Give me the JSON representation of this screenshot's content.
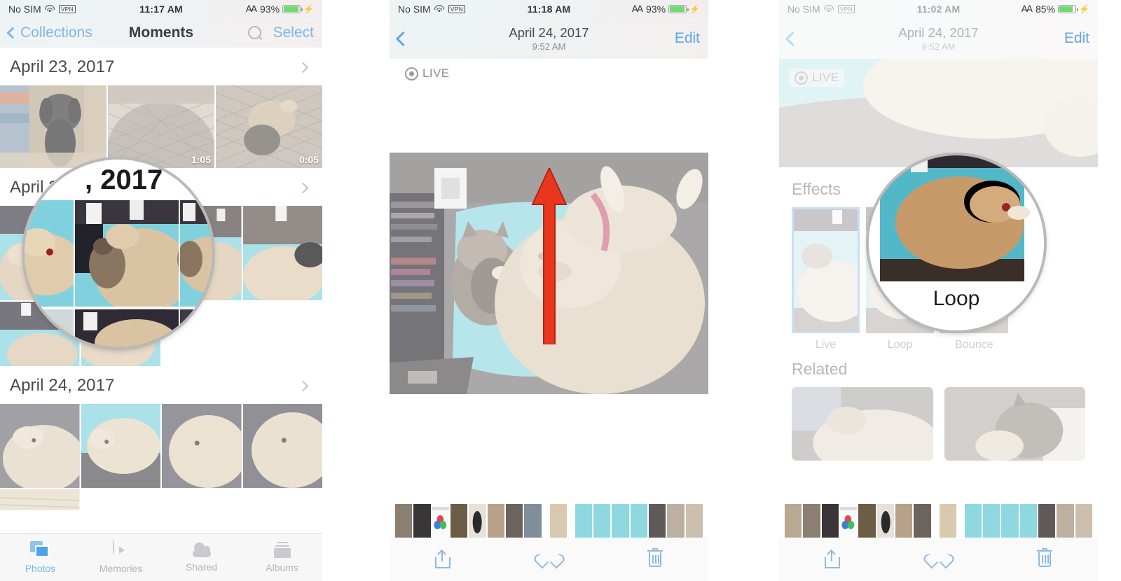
{
  "panels": [
    {
      "id": "moments-grid",
      "status": {
        "carrier": "No SIM",
        "wifi_icon": "wifi-icon",
        "vpn": "VPN",
        "time": "11:17 AM",
        "bluetooth_icon": "bluetooth-icon",
        "battery_pct": "93%",
        "charging_icon": "lightning-bolt-icon"
      },
      "nav": {
        "back_label": "Collections",
        "title": "Moments",
        "search_icon": "search-icon",
        "action_label": "Select"
      },
      "sections": [
        {
          "date": "April 23, 2017",
          "durations": [
            "",
            "1:05",
            "0:05"
          ]
        },
        {
          "date": "April 24, 2017",
          "durations": []
        },
        {
          "date": "April 24, 2017",
          "durations": []
        }
      ],
      "magnified_text": "2017",
      "tabs": [
        {
          "label": "Photos",
          "icon": "photos-icon",
          "active": true
        },
        {
          "label": "Memories",
          "icon": "memories-icon",
          "active": false
        },
        {
          "label": "Shared",
          "icon": "cloud-icon",
          "active": false
        },
        {
          "label": "Albums",
          "icon": "albums-icon",
          "active": false
        }
      ]
    },
    {
      "id": "photo-detail",
      "status": {
        "carrier": "No SIM",
        "wifi_icon": "wifi-icon",
        "vpn": "VPN",
        "time": "11:18 AM",
        "bluetooth_icon": "bluetooth-icon",
        "battery_pct": "93%",
        "charging_icon": "lightning-bolt-icon"
      },
      "nav": {
        "back_icon": "back-chevron-icon",
        "title": "April 24, 2017",
        "subtitle": "9:52 AM",
        "action_label": "Edit"
      },
      "live_badge": "LIVE",
      "gesture": {
        "type": "swipe-up-arrow",
        "color": "#e8361f"
      },
      "toolbar": {
        "share_icon": "share-icon",
        "favorite_icon": "heart-icon",
        "delete_icon": "trash-icon"
      }
    },
    {
      "id": "live-effects",
      "status": {
        "carrier": "No SIM",
        "wifi_icon": "wifi-icon",
        "vpn": "VPN",
        "time": "11:02 AM",
        "bluetooth_icon": "bluetooth-icon",
        "battery_pct": "85%",
        "charging_icon": "lightning-bolt-icon"
      },
      "nav": {
        "back_icon": "back-chevron-icon",
        "title": "April 24, 2017",
        "subtitle": "9:52 AM",
        "action_label": "Edit"
      },
      "live_badge": "LIVE",
      "effects_title": "Effects",
      "effects": [
        {
          "label": "Live",
          "selected": true
        },
        {
          "label": "Loop",
          "selected": false
        },
        {
          "label": "Bounce",
          "selected": false
        }
      ],
      "magnified_caption": "Loop",
      "related_title": "Related",
      "toolbar": {
        "share_icon": "share-icon",
        "favorite_icon": "heart-icon",
        "delete_icon": "trash-icon"
      }
    }
  ],
  "colors": {
    "ios_blue": "#5fa8e8",
    "selected_blue": "#3b8fe0",
    "arrow_red": "#e8361f",
    "battery_green": "#6fdb6f"
  }
}
